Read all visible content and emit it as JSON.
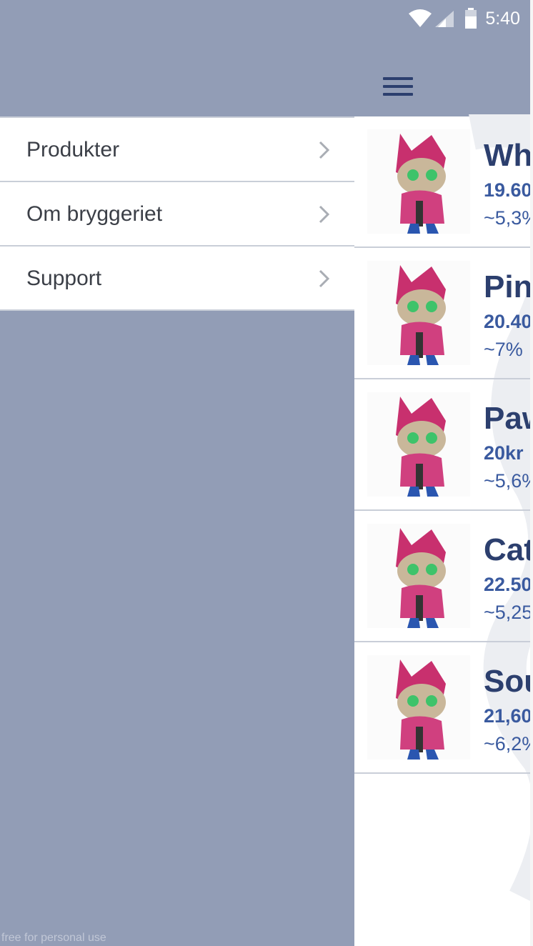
{
  "status_bar": {
    "time": "5:40",
    "icons": [
      "wifi-icon",
      "signal-icon",
      "battery-icon"
    ]
  },
  "toolbar": {
    "menu_icon": "hamburger-menu-icon"
  },
  "drawer": {
    "items": [
      {
        "label": "Produkter"
      },
      {
        "label": "Om bryggeriet"
      },
      {
        "label": "Support"
      }
    ],
    "footer_note": "free for personal use"
  },
  "products": [
    {
      "name": "Wh",
      "price": "19.60",
      "abv": "~5,3%"
    },
    {
      "name": "Pin",
      "price": "20.40",
      "abv": "~7%"
    },
    {
      "name": "Paw",
      "price": "20kr",
      "abv": "~5,6%"
    },
    {
      "name": "Cat",
      "price": "22.50",
      "abv": "~5,25"
    },
    {
      "name": "Sou",
      "price": "21,60",
      "abv": "~6,2%"
    }
  ],
  "colors": {
    "drawer_bg": "#929db6",
    "header_bg": "#929db6",
    "title_blue": "#2c3f6e",
    "price_blue": "#3a5a9f",
    "divider": "#c9ced8"
  }
}
